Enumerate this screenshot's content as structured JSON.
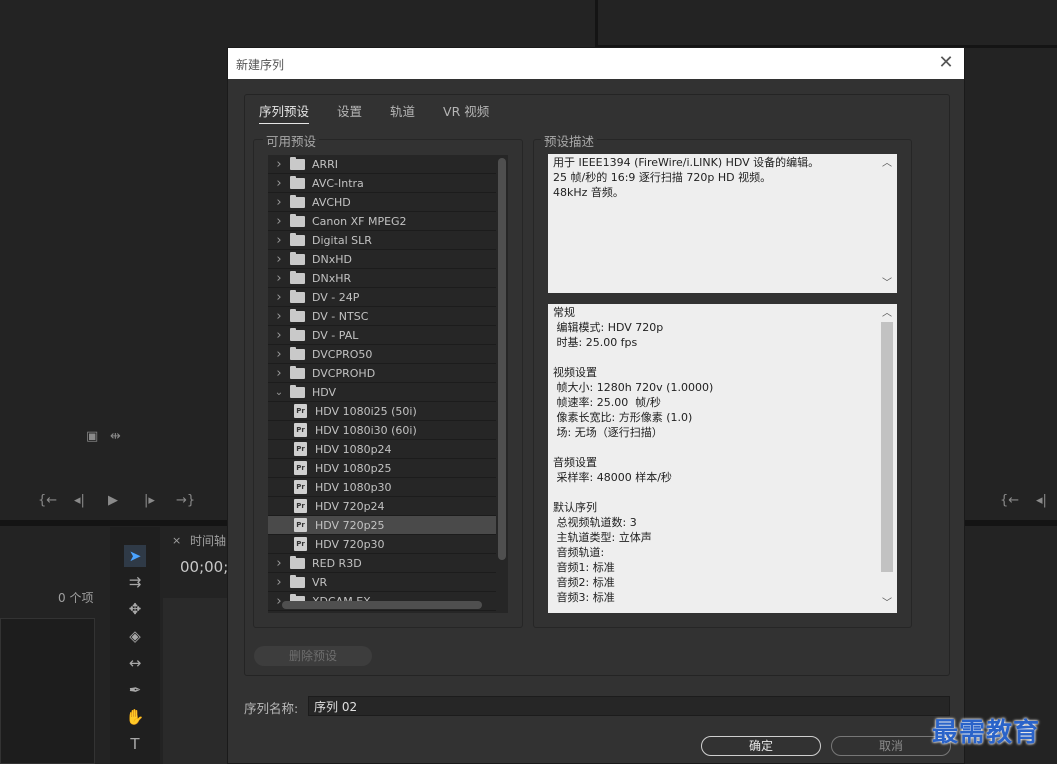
{
  "background": {
    "item_count": "0 个项",
    "timeline_tab": "时间轴",
    "timecode": "00;00;"
  },
  "dialog": {
    "title": "新建序列",
    "tabs": [
      {
        "label": "序列预设"
      },
      {
        "label": "设置"
      },
      {
        "label": "轨道"
      },
      {
        "label": "VR 视频"
      }
    ],
    "available_presets_label": "可用预设",
    "preset_description_label": "预设描述",
    "presets": [
      {
        "label": "ARRI",
        "type": "folder",
        "expanded": false
      },
      {
        "label": "AVC-Intra",
        "type": "folder",
        "expanded": false
      },
      {
        "label": "AVCHD",
        "type": "folder",
        "expanded": false
      },
      {
        "label": "Canon XF MPEG2",
        "type": "folder",
        "expanded": false
      },
      {
        "label": "Digital SLR",
        "type": "folder",
        "expanded": false
      },
      {
        "label": "DNxHD",
        "type": "folder",
        "expanded": false
      },
      {
        "label": "DNxHR",
        "type": "folder",
        "expanded": false
      },
      {
        "label": "DV - 24P",
        "type": "folder",
        "expanded": false
      },
      {
        "label": "DV - NTSC",
        "type": "folder",
        "expanded": false
      },
      {
        "label": "DV - PAL",
        "type": "folder",
        "expanded": false
      },
      {
        "label": "DVCPRO50",
        "type": "folder",
        "expanded": false
      },
      {
        "label": "DVCPROHD",
        "type": "folder",
        "expanded": false
      },
      {
        "label": "HDV",
        "type": "folder",
        "expanded": true
      },
      {
        "label": "HDV 1080i25 (50i)",
        "type": "preset"
      },
      {
        "label": "HDV 1080i30 (60i)",
        "type": "preset"
      },
      {
        "label": "HDV 1080p24",
        "type": "preset"
      },
      {
        "label": "HDV 1080p25",
        "type": "preset"
      },
      {
        "label": "HDV 1080p30",
        "type": "preset"
      },
      {
        "label": "HDV 720p24",
        "type": "preset"
      },
      {
        "label": "HDV 720p25",
        "type": "preset",
        "selected": true
      },
      {
        "label": "HDV 720p30",
        "type": "preset"
      },
      {
        "label": "RED R3D",
        "type": "folder",
        "expanded": false
      },
      {
        "label": "VR",
        "type": "folder",
        "expanded": false
      },
      {
        "label": "XDCAM EX",
        "type": "folder",
        "expanded": false
      }
    ],
    "preset_icon_text": "Pr",
    "description_summary": [
      "用于 IEEE1394 (FireWire/i.LINK) HDV 设备的编辑。",
      "25 帧/秒的 16:9 逐行扫描 720p HD 视频。",
      "48kHz 音频。"
    ],
    "description_details": [
      "常规",
      " 编辑模式: HDV 720p",
      " 时基: 25.00 fps",
      "",
      "视频设置",
      " 帧大小: 1280h 720v (1.0000)",
      " 帧速率: 25.00  帧/秒",
      " 像素长宽比: 方形像素 (1.0)",
      " 场: 无场（逐行扫描）",
      "",
      "音频设置",
      " 采样率: 48000 样本/秒",
      "",
      "默认序列",
      " 总视频轨道数: 3",
      " 主轨道类型: 立体声",
      " 音频轨道:",
      " 音频1: 标准",
      " 音频2: 标准",
      " 音频3: 标准"
    ],
    "delete_preset_label": "删除预设",
    "sequence_name_label": "序列名称:",
    "sequence_name_value": "序列 02",
    "ok_label": "确定",
    "cancel_label": "取消"
  },
  "watermark": "最需教育"
}
